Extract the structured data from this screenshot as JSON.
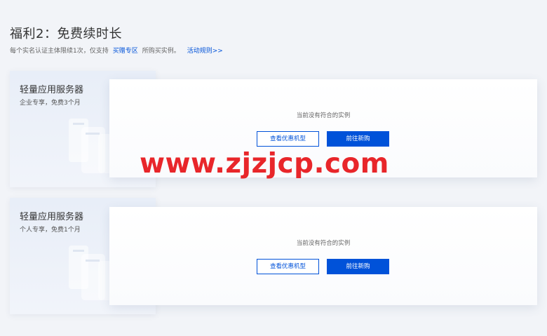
{
  "section": {
    "title": "福利2：免费续时长",
    "desc_prefix": "每个实名认证主体限续1次，仅支持",
    "desc_link": "买赠专区",
    "desc_suffix": "所购买实例。",
    "rules_link": "活动规则>>"
  },
  "cards": [
    {
      "title": "轻量应用服务器",
      "subtitle": "企业专享，免费3个月",
      "empty_text": "当前没有符合的实例",
      "view_button": "查看优惠机型",
      "buy_button": "前往新购"
    },
    {
      "title": "轻量应用服务器",
      "subtitle": "个人专享，免费1个月",
      "empty_text": "当前没有符合的实例",
      "view_button": "查看优惠机型",
      "buy_button": "前往新购"
    }
  ],
  "watermark": "www.zjzjcp.com",
  "colors": {
    "accent": "#0052d9",
    "watermark": "#e8262a",
    "background": "#f2f4f8"
  }
}
